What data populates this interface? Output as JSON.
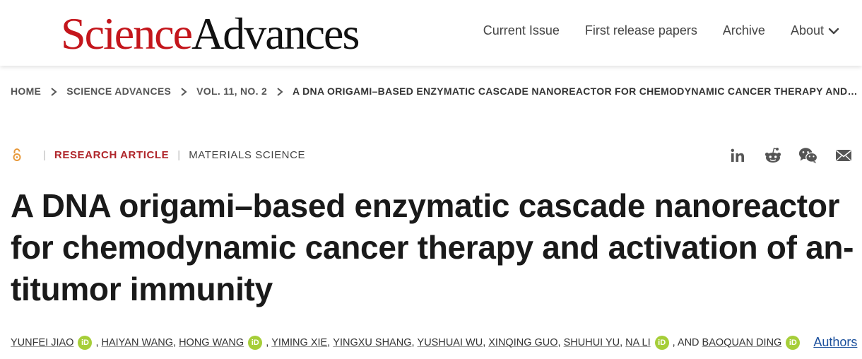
{
  "brand": {
    "science": "Science",
    "advances": "Advances"
  },
  "nav": [
    {
      "label": "Current Issue"
    },
    {
      "label": "First release papers"
    },
    {
      "label": "Archive"
    },
    {
      "label": "About"
    }
  ],
  "breadcrumb": [
    {
      "label": "HOME"
    },
    {
      "label": "SCIENCE ADVANCES"
    },
    {
      "label": "VOL. 11, NO. 2"
    },
    {
      "label": "A DNA ORIGAMI–BASED ENZYMATIC CASCADE NANOREACTOR FOR CHEMODYNAMIC CANCER THERAPY AND…"
    }
  ],
  "article": {
    "type": "RESEARCH ARTICLE",
    "subject": "MATERIALS SCIENCE",
    "title": "A DNA origami–based enzymatic cascade nanoreactor for chemodynamic cancer therapy and activation of antitumor immunity",
    "title_lines": [
      "A DNA origami–based enzymatic cascade nanoreactor",
      "for chemodynamic cancer therapy and activation of an-",
      "titumor immunity"
    ]
  },
  "authors": {
    "names": [
      "YUNFEI JIAO",
      "HAIYAN WANG",
      "HONG WANG",
      "YIMING XIE",
      "YINGXU SHANG",
      "YUSHUAI WU",
      "XINQING GUO",
      "SHUHUI YU",
      "NA LI",
      "BAOQUAN DING"
    ],
    "and_text": ", AND",
    "orcid_label": "iD",
    "link_label": "Authors"
  },
  "share_icons": [
    "linkedin-icon",
    "reddit-icon",
    "wechat-icon",
    "email-icon"
  ],
  "colors": {
    "brand_red": "#c4161c",
    "article_type": "#b0262b",
    "orcid_green": "#a6ce39",
    "open_access": "#e89a3c",
    "link_blue": "#1a4f9c"
  }
}
